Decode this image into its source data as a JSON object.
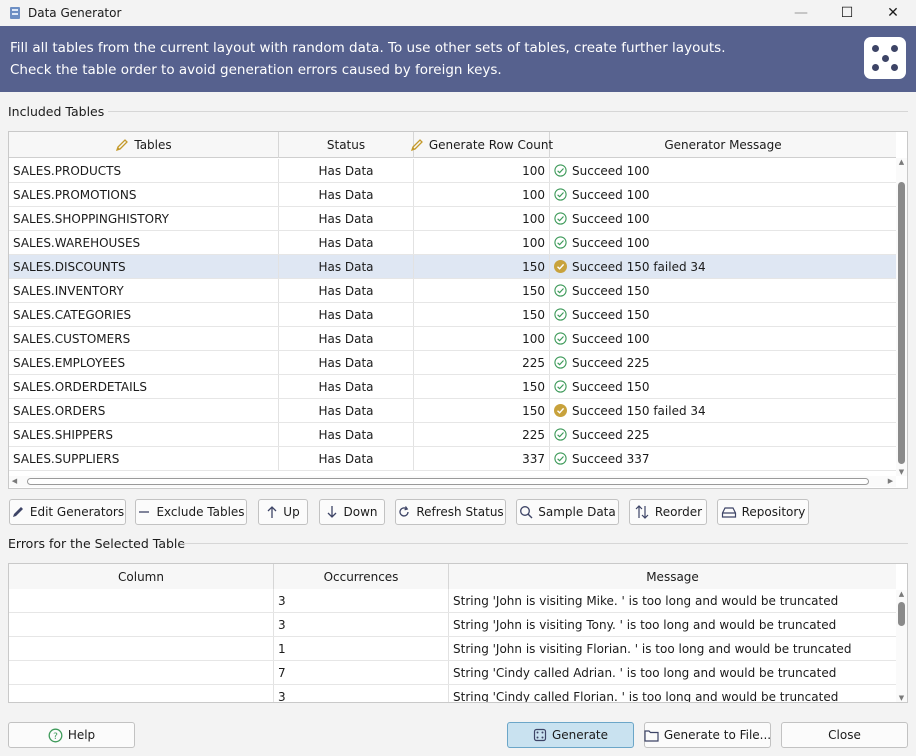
{
  "window": {
    "title": "Data Generator",
    "controls": {
      "minimize": "—",
      "maximize": "☐",
      "close": "✕"
    }
  },
  "banner": {
    "line1": "Fill all tables from the current layout with random data. To use other sets of tables, create further layouts.",
    "line2": "Check the table order to avoid generation errors caused by foreign keys.",
    "icon": "dice-icon"
  },
  "included_tables": {
    "label": "Included Tables",
    "columns": [
      "Tables",
      "Status",
      "Generate Row Count",
      "Generator Message"
    ],
    "rows": [
      {
        "table": "SALES.PRODUCTS",
        "status": "Has Data",
        "count": "100",
        "message": "Succeed 100",
        "state": "ok"
      },
      {
        "table": "SALES.PROMOTIONS",
        "status": "Has Data",
        "count": "100",
        "message": "Succeed 100",
        "state": "ok"
      },
      {
        "table": "SALES.SHOPPINGHISTORY",
        "status": "Has Data",
        "count": "100",
        "message": "Succeed 100",
        "state": "ok"
      },
      {
        "table": "SALES.WAREHOUSES",
        "status": "Has Data",
        "count": "100",
        "message": "Succeed 100",
        "state": "ok"
      },
      {
        "table": "SALES.DISCOUNTS",
        "status": "Has Data",
        "count": "150",
        "message": "Succeed 150 failed 34",
        "state": "warn",
        "selected": true
      },
      {
        "table": "SALES.INVENTORY",
        "status": "Has Data",
        "count": "150",
        "message": "Succeed 150",
        "state": "ok"
      },
      {
        "table": "SALES.CATEGORIES",
        "status": "Has Data",
        "count": "150",
        "message": "Succeed 150",
        "state": "ok"
      },
      {
        "table": "SALES.CUSTOMERS",
        "status": "Has Data",
        "count": "100",
        "message": "Succeed 100",
        "state": "ok"
      },
      {
        "table": "SALES.EMPLOYEES",
        "status": "Has Data",
        "count": "225",
        "message": "Succeed 225",
        "state": "ok"
      },
      {
        "table": "SALES.ORDERDETAILS",
        "status": "Has Data",
        "count": "150",
        "message": "Succeed 150",
        "state": "ok"
      },
      {
        "table": "SALES.ORDERS",
        "status": "Has Data",
        "count": "150",
        "message": "Succeed 150 failed 34",
        "state": "warn"
      },
      {
        "table": "SALES.SHIPPERS",
        "status": "Has Data",
        "count": "225",
        "message": "Succeed 225",
        "state": "ok"
      },
      {
        "table": "SALES.SUPPLIERS",
        "status": "Has Data",
        "count": "337",
        "message": "Succeed 337",
        "state": "ok"
      }
    ]
  },
  "toolbar": [
    {
      "label": "Edit Generators",
      "icon": "pencil-icon"
    },
    {
      "label": "Exclude Tables",
      "icon": "minus-icon"
    },
    {
      "label": "Up",
      "icon": "arrow-up-icon"
    },
    {
      "label": "Down",
      "icon": "arrow-down-icon"
    },
    {
      "label": "Refresh Status",
      "icon": "refresh-icon"
    },
    {
      "label": "Sample Data",
      "icon": "search-icon"
    },
    {
      "label": "Reorder",
      "icon": "reorder-icon"
    },
    {
      "label": "Repository",
      "icon": "repository-icon"
    }
  ],
  "errors": {
    "label": "Errors for the Selected Table",
    "columns": [
      "Column",
      "Occurrences",
      "Message"
    ],
    "rows": [
      {
        "column": "",
        "occurrences": "3",
        "message": "String 'John is visiting Mike. ' is too long and would be truncated"
      },
      {
        "column": "",
        "occurrences": "3",
        "message": "String 'John is visiting Tony. ' is too long and would be truncated"
      },
      {
        "column": "",
        "occurrences": "1",
        "message": "String 'John is visiting Florian. ' is too long and would be truncated"
      },
      {
        "column": "",
        "occurrences": "7",
        "message": "String 'Cindy called Adrian. ' is too long and would be truncated"
      },
      {
        "column": "",
        "occurrences": "3",
        "message": "String 'Cindy called Florian. ' is too long and would be truncated"
      }
    ]
  },
  "footer": {
    "help": "Help",
    "generate": "Generate",
    "generate_to_file": "Generate to File...",
    "close": "Close"
  },
  "colors": {
    "banner": "#56618e",
    "selected_row": "#dfe7f3",
    "success": "#3e9a5a",
    "warning": "#c8a23c",
    "primary_button": "#c9e2f0"
  }
}
